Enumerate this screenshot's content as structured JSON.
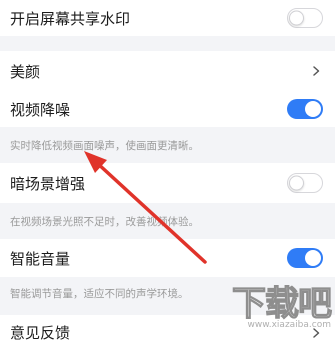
{
  "settings": {
    "screen_watermark": {
      "label": "开启屏幕共享水印",
      "enabled": false
    },
    "beauty": {
      "label": "美颜"
    },
    "noise_reduction": {
      "label": "视频降噪",
      "enabled": true,
      "description": "实时降低视频画面噪声，使画面更清晰。"
    },
    "low_light": {
      "label": "暗场景增强",
      "enabled": false,
      "description": "在视频场景光照不足时，改善视频体验。"
    },
    "smart_volume": {
      "label": "智能音量",
      "enabled": true,
      "description": "智能调节音量，适应不同的声学环境。"
    },
    "feedback": {
      "label": "意见反馈"
    }
  },
  "colors": {
    "accent": "#2f7cf6",
    "annotation_arrow": "#e0332a"
  },
  "watermark": {
    "logo_text": "下载吧",
    "url_text": "www.xiazaiba.com"
  }
}
